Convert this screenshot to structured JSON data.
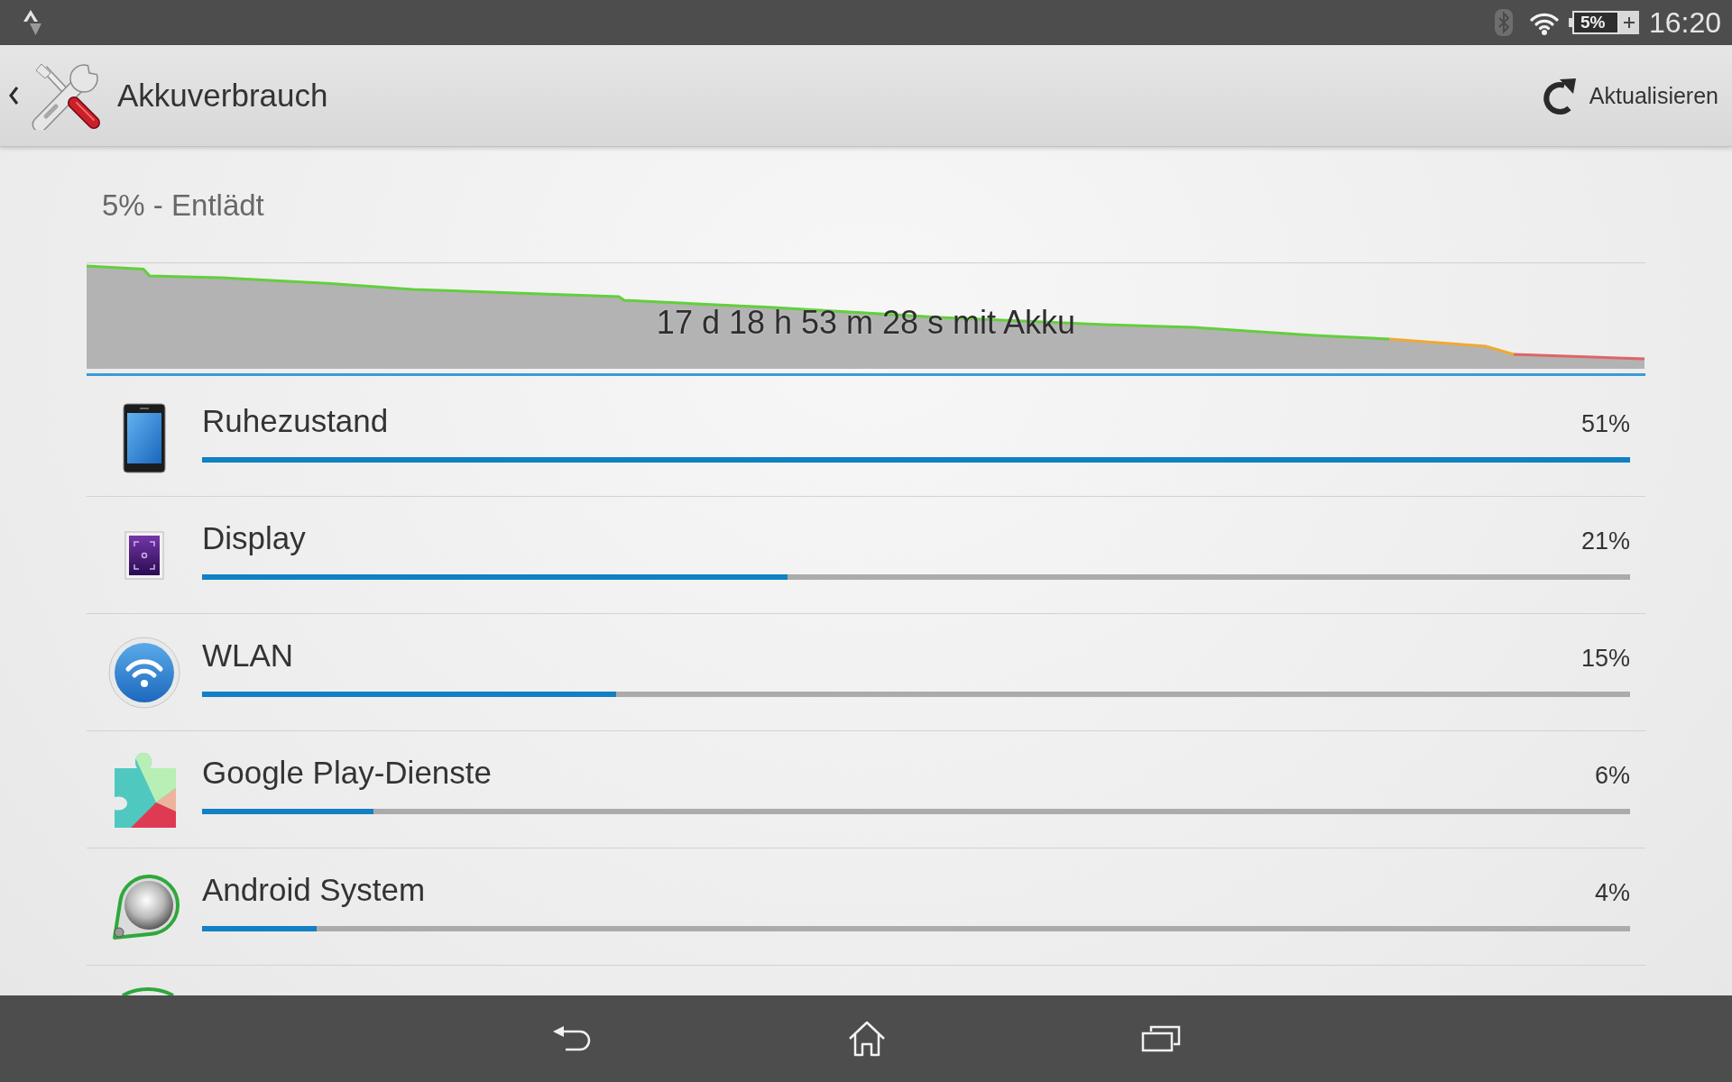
{
  "status_bar": {
    "battery": "5%",
    "time": "16:20"
  },
  "action_bar": {
    "title": "Akkuverbrauch",
    "action": "Aktualisieren"
  },
  "battery_status": "5% - Entlädt",
  "history_graph": {
    "caption": "17 d 18 h 53 m 28 s mit Akku"
  },
  "usage_list": [
    {
      "label": "Ruhezustand",
      "percentage": "51%",
      "level": 1.0
    },
    {
      "label": "Display",
      "percentage": "21%",
      "level": 0.41
    },
    {
      "label": "WLAN",
      "percentage": "15%",
      "level": 0.29
    },
    {
      "label": "Google Play-Dienste",
      "percentage": "6%",
      "level": 0.12
    },
    {
      "label": "Android System",
      "percentage": "4%",
      "level": 0.08
    }
  ]
}
